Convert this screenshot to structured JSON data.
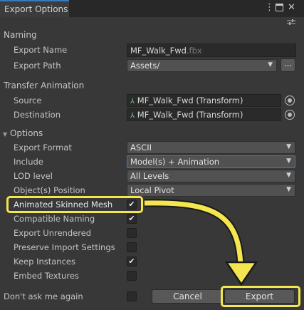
{
  "window": {
    "tab_title": "Export Options",
    "icons": [
      "more-vert-icon",
      "maximize-icon",
      "close-icon"
    ]
  },
  "naming": {
    "header": "Naming",
    "export_name_label": "Export Name",
    "export_name_value": "MF_Walk_Fwd",
    "export_name_ext": ".fbx",
    "export_path_label": "Export Path",
    "export_path_value": "Assets/",
    "browse_label": "..."
  },
  "transfer": {
    "header": "Transfer Animation",
    "source_label": "Source",
    "source_value": "MF_Walk_Fwd (Transform)",
    "destination_label": "Destination",
    "destination_value": "MF_Walk_Fwd (Transform)"
  },
  "options": {
    "header": "Options",
    "export_format_label": "Export Format",
    "export_format_value": "ASCII",
    "include_label": "Include",
    "include_value": "Model(s) + Animation",
    "lod_label": "LOD level",
    "lod_value": "All Levels",
    "object_position_label": "Object(s) Position",
    "object_position_value": "Local Pivot",
    "toggles": [
      {
        "label": "Animated Skinned Mesh",
        "checked": true
      },
      {
        "label": "Compatible Naming",
        "checked": true
      },
      {
        "label": "Export Unrendered",
        "checked": false
      },
      {
        "label": "Preserve Import Settings",
        "checked": false
      },
      {
        "label": "Keep Instances",
        "checked": true
      },
      {
        "label": "Embed Textures",
        "checked": false
      }
    ]
  },
  "footer": {
    "dont_ask_label": "Don't ask me again",
    "dont_ask_checked": false,
    "cancel_label": "Cancel",
    "export_label": "Export"
  },
  "annotation": {
    "highlight_color": "#f4e64e"
  }
}
